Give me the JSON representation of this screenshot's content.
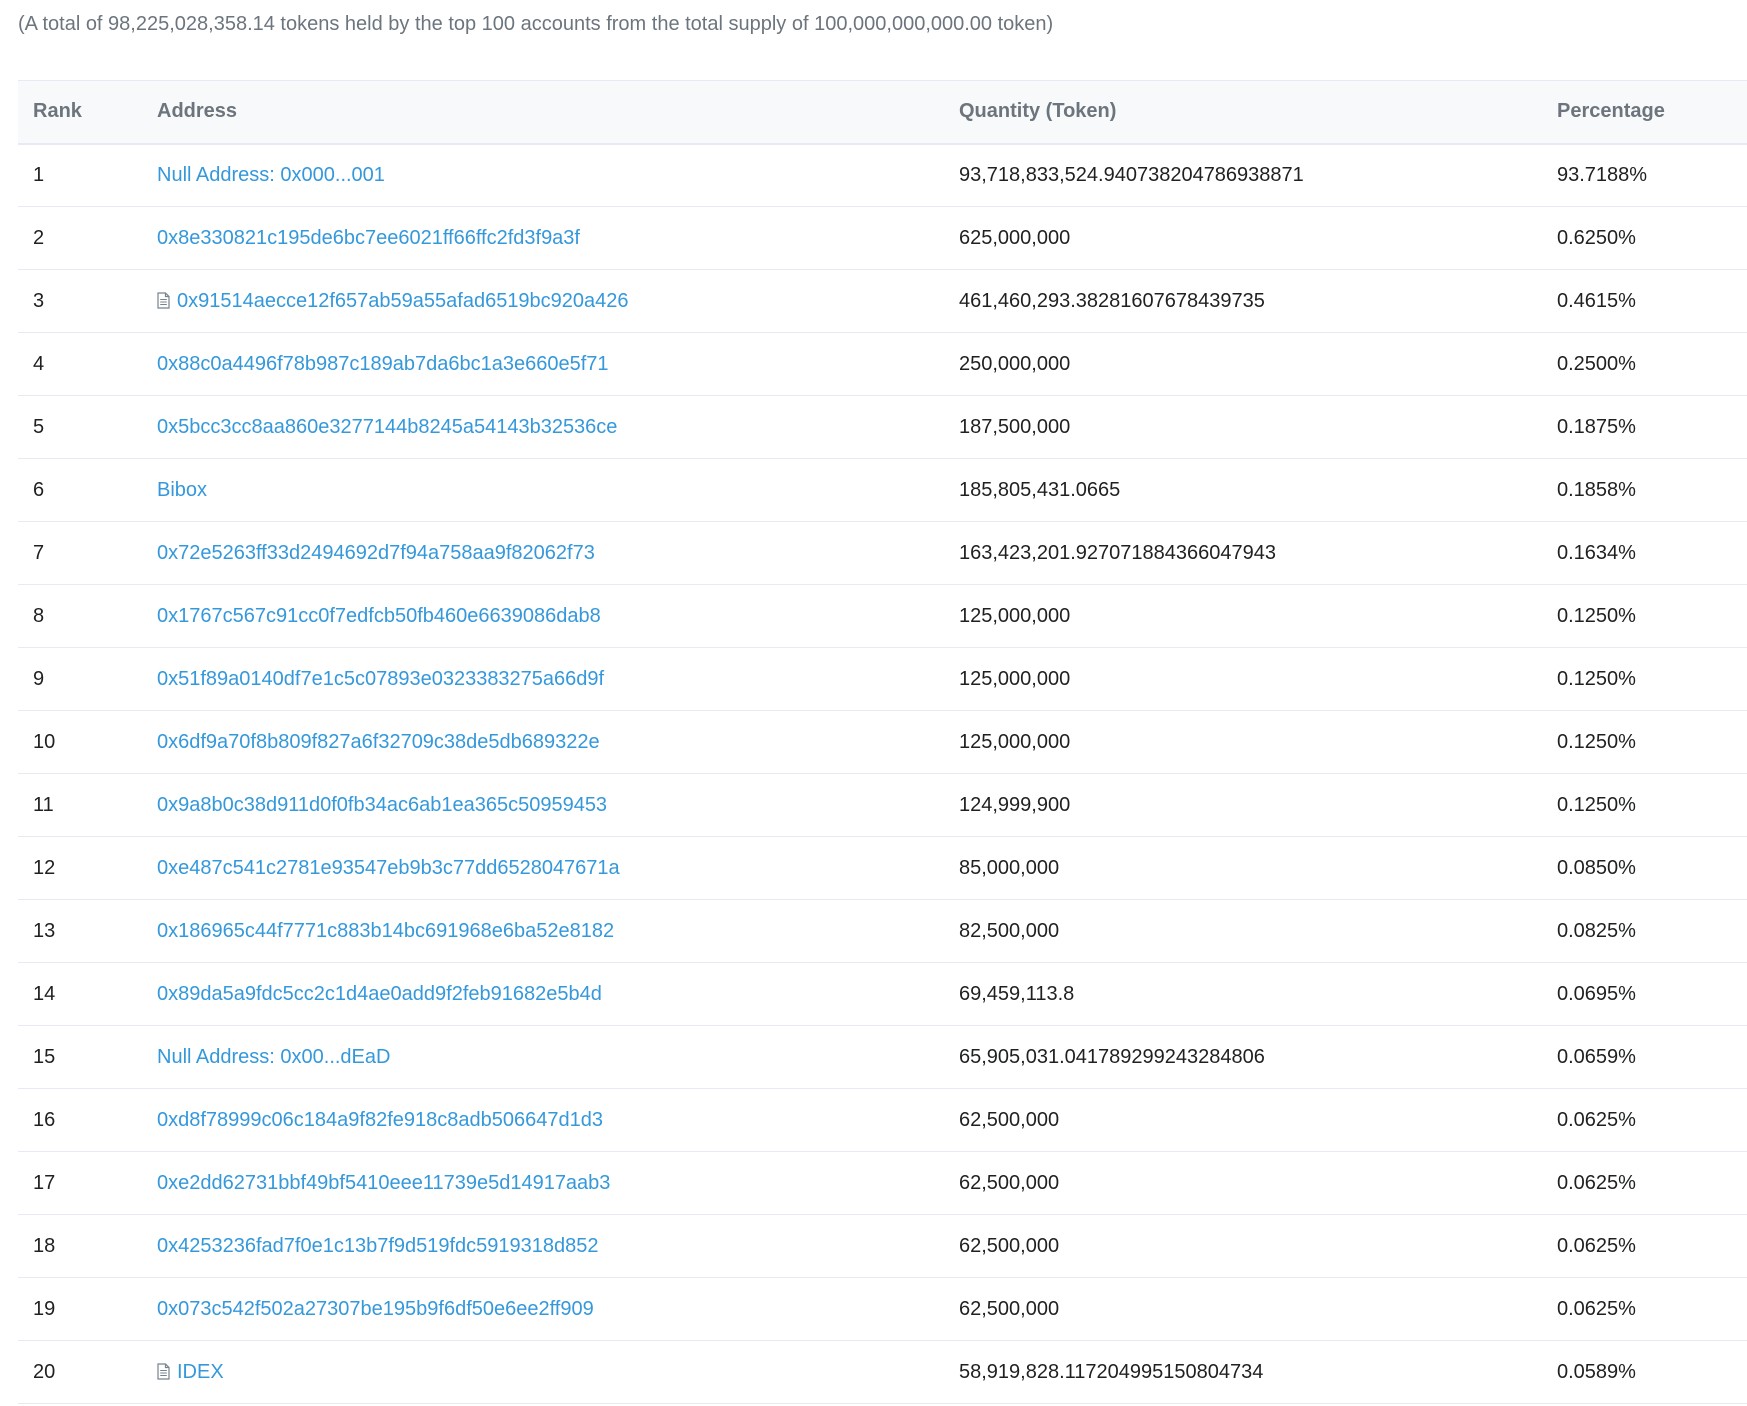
{
  "summary": "(A total of 98,225,028,358.14 tokens held by the top 100 accounts from the total supply of 100,000,000,000.00 token)",
  "columns": {
    "rank": "Rank",
    "address": "Address",
    "quantity": "Quantity (Token)",
    "percentage": "Percentage"
  },
  "rows": [
    {
      "rank": "1",
      "address": "Null Address: 0x000...001",
      "contract": false,
      "quantity": "93,718,833,524.940738204786938871",
      "percentage": "93.7188%"
    },
    {
      "rank": "2",
      "address": "0x8e330821c195de6bc7ee6021ff66ffc2fd3f9a3f",
      "contract": false,
      "quantity": "625,000,000",
      "percentage": "0.6250%"
    },
    {
      "rank": "3",
      "address": "0x91514aecce12f657ab59a55afad6519bc920a426",
      "contract": true,
      "quantity": "461,460,293.38281607678439735",
      "percentage": "0.4615%"
    },
    {
      "rank": "4",
      "address": "0x88c0a4496f78b987c189ab7da6bc1a3e660e5f71",
      "contract": false,
      "quantity": "250,000,000",
      "percentage": "0.2500%"
    },
    {
      "rank": "5",
      "address": "0x5bcc3cc8aa860e3277144b8245a54143b32536ce",
      "contract": false,
      "quantity": "187,500,000",
      "percentage": "0.1875%"
    },
    {
      "rank": "6",
      "address": "Bibox",
      "contract": false,
      "quantity": "185,805,431.0665",
      "percentage": "0.1858%"
    },
    {
      "rank": "7",
      "address": "0x72e5263ff33d2494692d7f94a758aa9f82062f73",
      "contract": false,
      "quantity": "163,423,201.927071884366047943",
      "percentage": "0.1634%"
    },
    {
      "rank": "8",
      "address": "0x1767c567c91cc0f7edfcb50fb460e6639086dab8",
      "contract": false,
      "quantity": "125,000,000",
      "percentage": "0.1250%"
    },
    {
      "rank": "9",
      "address": "0x51f89a0140df7e1c5c07893e0323383275a66d9f",
      "contract": false,
      "quantity": "125,000,000",
      "percentage": "0.1250%"
    },
    {
      "rank": "10",
      "address": "0x6df9a70f8b809f827a6f32709c38de5db689322e",
      "contract": false,
      "quantity": "125,000,000",
      "percentage": "0.1250%"
    },
    {
      "rank": "11",
      "address": "0x9a8b0c38d911d0f0fb34ac6ab1ea365c50959453",
      "contract": false,
      "quantity": "124,999,900",
      "percentage": "0.1250%"
    },
    {
      "rank": "12",
      "address": "0xe487c541c2781e93547eb9b3c77dd6528047671a",
      "contract": false,
      "quantity": "85,000,000",
      "percentage": "0.0850%"
    },
    {
      "rank": "13",
      "address": "0x186965c44f7771c883b14bc691968e6ba52e8182",
      "contract": false,
      "quantity": "82,500,000",
      "percentage": "0.0825%"
    },
    {
      "rank": "14",
      "address": "0x89da5a9fdc5cc2c1d4ae0add9f2feb91682e5b4d",
      "contract": false,
      "quantity": "69,459,113.8",
      "percentage": "0.0695%"
    },
    {
      "rank": "15",
      "address": "Null Address: 0x00...dEaD",
      "contract": false,
      "quantity": "65,905,031.041789299243284806",
      "percentage": "0.0659%"
    },
    {
      "rank": "16",
      "address": "0xd8f78999c06c184a9f82fe918c8adb506647d1d3",
      "contract": false,
      "quantity": "62,500,000",
      "percentage": "0.0625%"
    },
    {
      "rank": "17",
      "address": "0xe2dd62731bbf49bf5410eee11739e5d14917aab3",
      "contract": false,
      "quantity": "62,500,000",
      "percentage": "0.0625%"
    },
    {
      "rank": "18",
      "address": "0x4253236fad7f0e1c13b7f9d519fdc5919318d852",
      "contract": false,
      "quantity": "62,500,000",
      "percentage": "0.0625%"
    },
    {
      "rank": "19",
      "address": "0x073c542f502a27307be195b9f6df50e6ee2ff909",
      "contract": false,
      "quantity": "62,500,000",
      "percentage": "0.0625%"
    },
    {
      "rank": "20",
      "address": "IDEX",
      "contract": true,
      "quantity": "58,919,828.117204995150804734",
      "percentage": "0.0589%"
    }
  ],
  "icons": {
    "contract": "file-text-icon"
  },
  "colors": {
    "link": "#3498db",
    "muted": "#6c757d",
    "border": "#e7eaf3"
  }
}
